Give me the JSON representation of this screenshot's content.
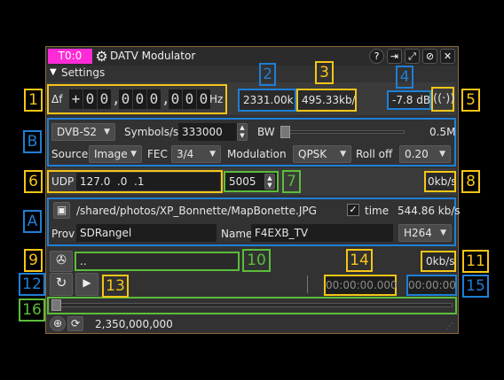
{
  "titlebar": {
    "channel_badge": "T0:0",
    "title": "DATV Modulator",
    "colors": {
      "badge": "#ff2bd6",
      "frame": "#8a6a3a"
    }
  },
  "settings": {
    "label": "Settings"
  },
  "frequency": {
    "delta_label": "Δf",
    "sign": "+",
    "digits": [
      "0",
      "0",
      "0",
      "0",
      "0",
      "0",
      "0",
      "0",
      "0"
    ],
    "unit": "Hz"
  },
  "bandwidth_readout": "2331.00k",
  "bitrate_readout": "495.33kb/s",
  "power_readout": "-7.8 dB",
  "mode_row": {
    "standard": "DVB-S2",
    "symbols_label": "Symbols/s",
    "symbols_value": "333000",
    "bw_label": "BW",
    "bw_value": "0.5M"
  },
  "source_row": {
    "source_label": "Source",
    "source_value": "Image",
    "fec_label": "FEC",
    "fec_value": "3/4",
    "modulation_label": "Modulation",
    "modulation_value": "QPSK",
    "rolloff_label": "Roll off",
    "rolloff_value": "0.20"
  },
  "udp_row": {
    "udp_label": "UDP",
    "udp_address": "127.0  .0  .1",
    "udp_port": "5005",
    "udp_rate": "0kb/s"
  },
  "image_row": {
    "path": "/shared/photos/XP_Bonnette/MapBonette.JPG",
    "time_label": "time",
    "time_checked": true,
    "rate": "544.86 kb/s"
  },
  "provider_row": {
    "prov_label": "Prov",
    "prov_value": "SDRangel",
    "name_label": "Name",
    "name_value": "F4EXB_TV",
    "codec": "H264"
  },
  "file_row": {
    "file_value": "..",
    "file_rate": "0kb/s"
  },
  "playback_row": {
    "elapsed": "00:00:00.000",
    "total": "00:00:00"
  },
  "bottom": {
    "frequency": "2,350,000,000"
  },
  "annotations": {
    "yellow": [
      "1",
      "3",
      "5",
      "6",
      "8",
      "9",
      "11",
      "13",
      "14"
    ],
    "blue": [
      "2",
      "4",
      "A",
      "B",
      "12",
      "15"
    ],
    "green": [
      "7",
      "10",
      "16"
    ],
    "colors": {
      "yellow": "#f5c518",
      "blue": "#1e7fd6",
      "green": "#5bbd3a"
    }
  },
  "icons": [
    "gear-icon",
    "help-icon",
    "move-out-icon",
    "maximize-icon",
    "hide-icon",
    "close-icon",
    "triangle-down-icon",
    "antenna-icon",
    "image-icon",
    "film-reel-icon",
    "loop-icon",
    "play-icon",
    "plus-icon",
    "go-icon",
    "resize-grip-icon"
  ]
}
